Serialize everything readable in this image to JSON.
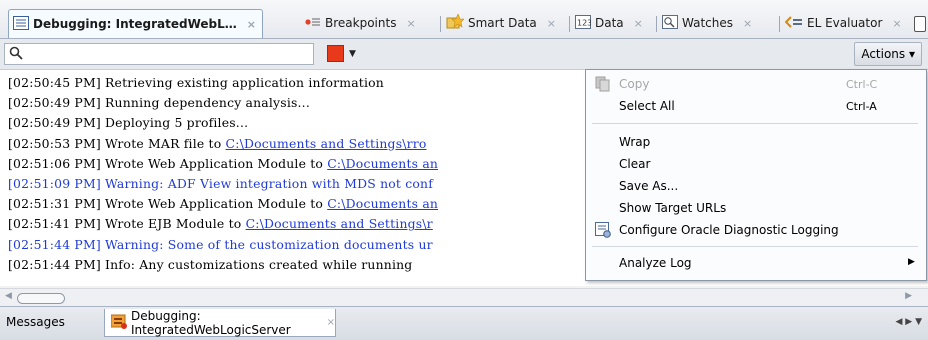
{
  "tabs": [
    {
      "label": "Debugging: IntegratedWebL…",
      "icon": "log-window-icon"
    },
    {
      "label": "Breakpoints",
      "icon": "breakpoints-icon"
    },
    {
      "label": "Smart Data",
      "icon": "smart-data-icon"
    },
    {
      "label": "Data",
      "icon": "data-icon"
    },
    {
      "label": "Watches",
      "icon": "watches-icon"
    },
    {
      "label": "EL Evaluator",
      "icon": "el-evaluator-icon"
    }
  ],
  "tab_close": "×",
  "toolbar": {
    "search_placeholder": "",
    "actions_label": "Actions ▾"
  },
  "log_lines": [
    {
      "ts": "[02:50:45 PM]",
      "text": " Retrieving existing application information",
      "link": "",
      "warn": false
    },
    {
      "ts": "[02:50:49 PM]",
      "text": " Running dependency analysis...",
      "link": "",
      "warn": false
    },
    {
      "ts": "[02:50:49 PM]",
      "text": " Deploying 5 profiles...",
      "link": "",
      "warn": false
    },
    {
      "ts": "[02:50:53 PM]",
      "text": " Wrote MAR file to ",
      "link": "C:\\Documents and Settings\\rro",
      "warn": false
    },
    {
      "ts": "[02:51:06 PM]",
      "text": " Wrote Web Application Module to ",
      "link": "C:\\Documents an",
      "warn": false
    },
    {
      "ts": "[02:51:09 PM]",
      "text": " Warning: ADF View integration with MDS not conf",
      "link": "",
      "warn": true
    },
    {
      "ts": "[02:51:31 PM]",
      "text": " Wrote Web Application Module to ",
      "link": "C:\\Documents an",
      "warn": false
    },
    {
      "ts": "[02:51:41 PM]",
      "text": " Wrote EJB Module to ",
      "link": "C:\\Documents and Settings\\r",
      "warn": false
    },
    {
      "ts": "[02:51:44 PM]",
      "text": " Warning: Some of the customization documents ur",
      "link": "",
      "warn": true
    },
    {
      "ts": "[02:51:44 PM]",
      "text": " Info: Any customizations created while running ",
      "link": "",
      "warn": false
    }
  ],
  "context_menu": {
    "copy": {
      "label": "Copy",
      "shortcut": "Ctrl-C",
      "enabled": false
    },
    "select_all": {
      "label": "Select All",
      "shortcut": "Ctrl-A"
    },
    "wrap": "Wrap",
    "clear": "Clear",
    "save_as": "Save As...",
    "show_target_urls": "Show Target URLs",
    "configure_logging": "Configure Oracle Diagnostic Logging",
    "analyze_log": "Analyze Log"
  },
  "bottom_tabs": {
    "messages": "Messages",
    "debugging": "Debugging: IntegratedWebLogicServer"
  },
  "colors": {
    "accent_red": "#e8391a",
    "link_blue": "#1f3ad6"
  }
}
